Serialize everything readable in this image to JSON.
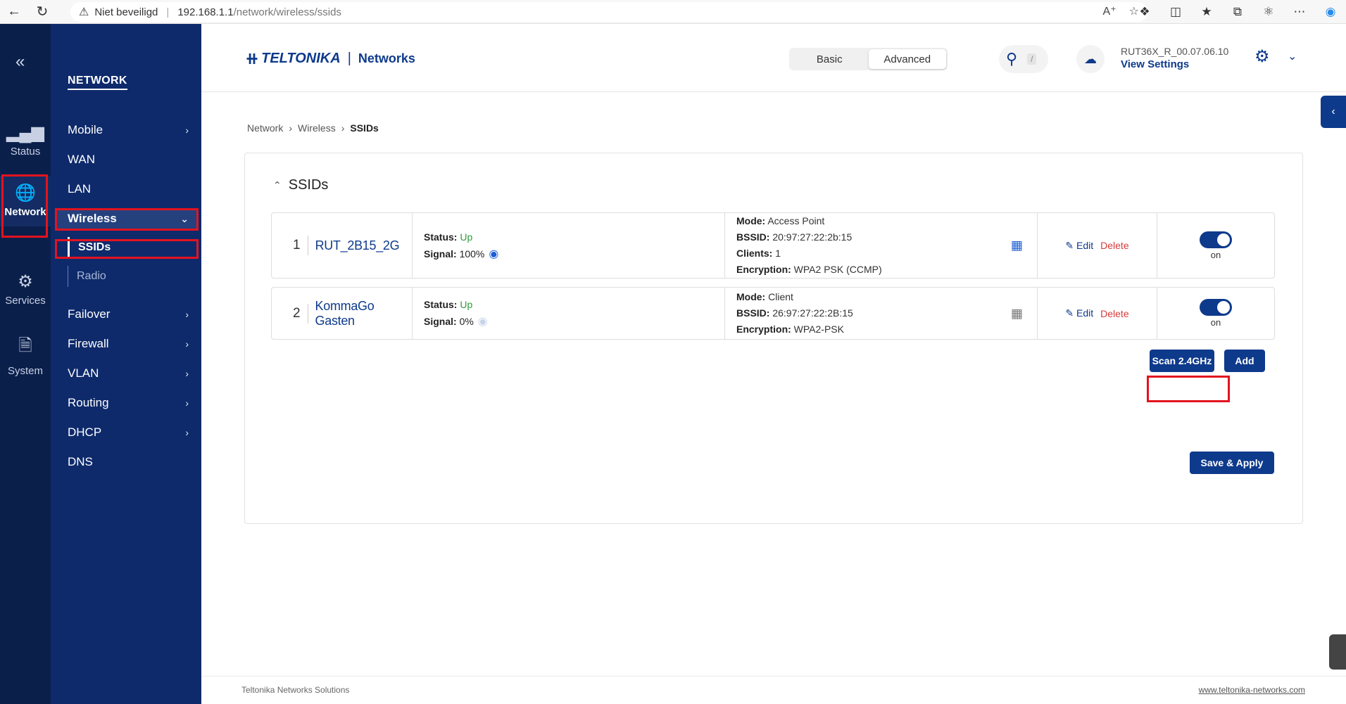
{
  "browser": {
    "security": "Niet beveiligd",
    "url_host": "192.168.1.1",
    "url_path": "/network/wireless/ssids"
  },
  "rail": {
    "items": [
      {
        "label": "Status",
        "icon": "signal-icon"
      },
      {
        "label": "Network",
        "icon": "globe-icon"
      },
      {
        "label": "Services",
        "icon": "gear-icon"
      },
      {
        "label": "System",
        "icon": "file-icon"
      }
    ]
  },
  "subnav": {
    "title": "NETWORK",
    "items": [
      {
        "label": "Mobile"
      },
      {
        "label": "WAN"
      },
      {
        "label": "LAN"
      },
      {
        "label": "Wireless"
      },
      {
        "label": "Failover"
      },
      {
        "label": "Firewall"
      },
      {
        "label": "VLAN"
      },
      {
        "label": "Routing"
      },
      {
        "label": "DHCP"
      },
      {
        "label": "DNS"
      }
    ],
    "wireless_sub": [
      {
        "label": "SSIDs"
      },
      {
        "label": "Radio"
      }
    ]
  },
  "header": {
    "logo_name": "TELTONIKA",
    "logo_sub": "Networks",
    "mode_basic": "Basic",
    "mode_advanced": "Advanced",
    "search_shortcut": "/",
    "firmware": "RUT36X_R_00.07.06.10",
    "view_settings": "View Settings"
  },
  "breadcrumb": {
    "items": [
      "Network",
      "Wireless",
      "SSIDs"
    ]
  },
  "panel": {
    "title": "SSIDs",
    "rows": [
      {
        "index": "1",
        "name": "RUT_2B15_2G",
        "status_label": "Status:",
        "status": "Up",
        "signal_label": "Signal:",
        "signal": "100%",
        "mode_label": "Mode:",
        "mode": "Access Point",
        "bssid_label": "BSSID:",
        "bssid": "20:97:27:22:2b:15",
        "clients_label": "Clients:",
        "clients": "1",
        "enc_label": "Encryption:",
        "encryption": "WPA2 PSK (CCMP)",
        "edit": "Edit",
        "delete": "Delete",
        "toggle": "on"
      },
      {
        "index": "2",
        "name": "KommaGo Gasten",
        "status_label": "Status:",
        "status": "Up",
        "signal_label": "Signal:",
        "signal": "0%",
        "mode_label": "Mode:",
        "mode": "Client",
        "bssid_label": "BSSID:",
        "bssid": "26:97:27:22:2B:15",
        "enc_label": "Encryption:",
        "encryption": "WPA2-PSK",
        "edit": "Edit",
        "delete": "Delete",
        "toggle": "on"
      }
    ],
    "scan_button": "Scan 2.4GHz",
    "add_button": "Add",
    "save_button": "Save & Apply"
  },
  "footer": {
    "left": "Teltonika Networks Solutions",
    "right": "www.teltonika-networks.com"
  },
  "colors": {
    "rail_bg": "#0b1f4b",
    "subnav_bg": "#0e2a6b",
    "accent": "#0e3a8c",
    "highlight": "#e3131e",
    "status_up": "#2e9b3a",
    "delete": "#d93a3a"
  }
}
